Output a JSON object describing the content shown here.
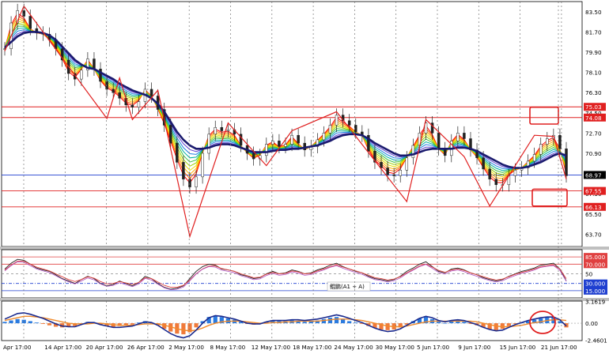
{
  "colors": {
    "grid": "#777777",
    "hline_red": "#e02020",
    "hline_blue": "#1f3fd0",
    "price_label_red": "#e02020",
    "price_label_black": "#000000",
    "ma_thick": "#1a1a6e",
    "zigzag": "#e02020",
    "osc_black": "#222222",
    "osc_red": "#e04040",
    "osc_blue": "#3050e0",
    "osc_purple": "#b050c0",
    "hist_blue": "#2a7be0",
    "hist_orange": "#f07a3a",
    "macd_line": "#1a2a8e",
    "signal_line": "#f08a2a",
    "ribbon": [
      "#ff0000",
      "#ff6a00",
      "#ffb000",
      "#e8e000",
      "#9ad000",
      "#40c040",
      "#00b0a0",
      "#2080e0",
      "#6040d0"
    ]
  },
  "chart_data": [
    {
      "type": "line",
      "panel": "price",
      "ylim": [
        62.6,
        84.4
      ],
      "price_labels": [
        "83.50",
        "81.70",
        "79.90",
        "78.10",
        "76.30",
        "74.50",
        "72.70",
        "70.90",
        "69.10",
        "67.30",
        "65.50",
        "63.70"
      ],
      "price_label_values": [
        83.5,
        81.7,
        79.9,
        78.1,
        76.3,
        74.5,
        72.7,
        70.9,
        69.1,
        67.3,
        65.5,
        63.7
      ],
      "highlighted_labels": [
        {
          "text": "75.03",
          "value": 75.03,
          "color": "#e02020"
        },
        {
          "text": "74.08",
          "value": 74.08,
          "color": "#e02020"
        },
        {
          "text": "68.97",
          "value": 68.97,
          "color": "#000000"
        },
        {
          "text": "67.55",
          "value": 67.55,
          "color": "#e02020"
        },
        {
          "text": "66.13",
          "value": 66.13,
          "color": "#e02020"
        }
      ],
      "horizontal_lines": [
        {
          "value": 75.03,
          "color": "#e02020"
        },
        {
          "value": 74.08,
          "color": "#e02020"
        },
        {
          "value": 68.97,
          "color": "#1f3fd0"
        },
        {
          "value": 67.55,
          "color": "#e02020"
        },
        {
          "value": 66.13,
          "color": "#e02020"
        }
      ],
      "price_close": [
        80.2,
        82.5,
        83.6,
        83.1,
        82.0,
        81.6,
        81.5,
        81.0,
        80.2,
        79.2,
        78.0,
        77.5,
        78.3,
        79.3,
        78.4,
        77.3,
        76.6,
        76.3,
        75.8,
        75.2,
        75.0,
        75.5,
        76.6,
        76.0,
        74.8,
        73.4,
        71.8,
        70.1,
        68.6,
        67.9,
        68.8,
        70.9,
        72.6,
        73.2,
        72.9,
        73.0,
        72.6,
        71.6,
        70.9,
        70.4,
        70.7,
        71.7,
        72.0,
        71.5,
        71.7,
        72.5,
        71.8,
        71.2,
        71.5,
        72.1,
        72.7,
        73.4,
        74.3,
        73.8,
        73.4,
        72.8,
        72.5,
        71.1,
        70.1,
        69.6,
        69.0,
        68.9,
        69.4,
        70.5,
        71.6,
        72.7,
        73.6,
        72.7,
        71.3,
        70.7,
        72.0,
        72.7,
        72.2,
        71.2,
        70.5,
        69.5,
        68.6,
        68.1,
        68.1,
        68.9,
        69.4,
        69.6,
        70.2,
        70.8,
        71.7,
        72.2,
        72.5,
        71.3,
        68.9
      ],
      "ma_thick": [
        80.3,
        80.8,
        81.3,
        81.6,
        81.7,
        81.7,
        81.6,
        81.4,
        81.0,
        80.4,
        79.8,
        79.2,
        78.8,
        78.5,
        78.4,
        78.1,
        77.8,
        77.5,
        77.1,
        76.8,
        76.5,
        76.3,
        76.1,
        75.8,
        75.3,
        74.6,
        73.7,
        72.8,
        72.1,
        71.6,
        71.3,
        71.3,
        71.4,
        71.6,
        71.7,
        71.7,
        71.6,
        71.4,
        71.2,
        71.0,
        71.0,
        71.0,
        71.1,
        71.2,
        71.2,
        71.3,
        71.3,
        71.4,
        71.5,
        71.6,
        71.8,
        72.0,
        72.3,
        72.5,
        72.6,
        72.6,
        72.5,
        72.2,
        71.8,
        71.5,
        71.2,
        70.9,
        70.7,
        70.7,
        70.8,
        71.0,
        71.2,
        71.3,
        71.3,
        71.3,
        71.3,
        71.4,
        71.4,
        71.3,
        71.1,
        70.8,
        70.5,
        70.2,
        69.9,
        69.7,
        69.6,
        69.6,
        69.7,
        69.9,
        70.1,
        70.4,
        70.7,
        70.9,
        70.7
      ],
      "zigzag": [
        {
          "i": 0,
          "v": 80.0
        },
        {
          "i": 3,
          "v": 84.0
        },
        {
          "i": 16,
          "v": 74.0
        },
        {
          "i": 18,
          "v": 77.6
        },
        {
          "i": 20,
          "v": 73.9
        },
        {
          "i": 24,
          "v": 76.5
        },
        {
          "i": 29,
          "v": 63.5
        },
        {
          "i": 35,
          "v": 73.6
        },
        {
          "i": 41,
          "v": 69.8
        },
        {
          "i": 45,
          "v": 72.9
        },
        {
          "i": 52,
          "v": 74.6
        },
        {
          "i": 63,
          "v": 66.6
        },
        {
          "i": 66,
          "v": 73.9
        },
        {
          "i": 72,
          "v": 70.6
        },
        {
          "i": 76,
          "v": 66.2
        },
        {
          "i": 83,
          "v": 72.5
        },
        {
          "i": 86,
          "v": 72.4
        },
        {
          "i": 88,
          "v": 68.6
        }
      ],
      "target_boxes": [
        {
          "top": 75.0,
          "bottom": 73.5
        },
        {
          "top": 67.7,
          "bottom": 66.2
        }
      ]
    },
    {
      "type": "line",
      "panel": "oscillator",
      "ylim": [
        0,
        100
      ],
      "labels": [
        {
          "text": "85.000",
          "value": 85
        },
        {
          "text": "70.000",
          "value": 70
        },
        {
          "text": "50",
          "value": 50
        },
        {
          "text": "30.000",
          "value": 30
        },
        {
          "text": "15.000",
          "value": 15
        }
      ],
      "legend_text": "鲲鹏(A1 + A)",
      "levels": [
        85,
        70,
        50,
        30,
        15
      ],
      "series": [
        {
          "values": [
            60,
            72,
            80,
            78,
            70,
            62,
            58,
            55,
            48,
            40,
            35,
            30,
            38,
            45,
            40,
            30,
            25,
            28,
            35,
            30,
            25,
            32,
            45,
            40,
            30,
            22,
            18,
            20,
            25,
            40,
            55,
            65,
            70,
            68,
            60,
            58,
            55,
            48,
            45,
            40,
            42,
            50,
            55,
            50,
            52,
            58,
            55,
            50,
            52,
            58,
            62,
            68,
            72,
            65,
            60,
            55,
            52,
            45,
            40,
            38,
            35,
            38,
            45,
            55,
            62,
            70,
            75,
            65,
            55,
            52,
            60,
            62,
            58,
            52,
            48,
            42,
            38,
            35,
            38,
            45,
            50,
            55,
            58,
            62,
            68,
            70,
            72,
            60,
            35
          ]
        },
        {
          "values": [
            58,
            68,
            76,
            76,
            70,
            64,
            60,
            56,
            50,
            44,
            38,
            34,
            38,
            44,
            41,
            34,
            29,
            30,
            34,
            31,
            28,
            32,
            42,
            40,
            33,
            26,
            22,
            22,
            26,
            37,
            50,
            60,
            66,
            66,
            61,
            58,
            55,
            50,
            46,
            42,
            43,
            49,
            53,
            50,
            51,
            56,
            54,
            50,
            51,
            56,
            60,
            65,
            68,
            64,
            60,
            56,
            52,
            47,
            42,
            40,
            37,
            39,
            44,
            52,
            59,
            66,
            70,
            64,
            57,
            53,
            58,
            60,
            57,
            52,
            48,
            44,
            40,
            37,
            39,
            44,
            49,
            53,
            56,
            60,
            65,
            67,
            68,
            60,
            40
          ]
        }
      ]
    },
    {
      "type": "bar",
      "panel": "macd",
      "ylim": [
        -2.5,
        3.2
      ],
      "labels": [
        {
          "text": "3.1619",
          "value": 3.1619
        },
        {
          "text": "0.00",
          "value": 0
        },
        {
          "text": "-2.4601",
          "value": -2.4601
        }
      ],
      "histogram": [
        0.2,
        0.4,
        0.6,
        0.5,
        0.3,
        0.1,
        -0.1,
        -0.3,
        -0.5,
        -0.6,
        -0.5,
        -0.4,
        -0.1,
        0.2,
        0.1,
        -0.2,
        -0.4,
        -0.5,
        -0.4,
        -0.3,
        -0.2,
        0.1,
        0.3,
        0.1,
        -0.3,
        -0.8,
        -1.2,
        -1.5,
        -1.6,
        -1.3,
        -0.6,
        0.3,
        0.9,
        1.1,
        0.9,
        0.7,
        0.5,
        0.2,
        -0.1,
        -0.2,
        -0.1,
        0.2,
        0.4,
        0.3,
        0.3,
        0.4,
        0.3,
        0.2,
        0.3,
        0.4,
        0.6,
        0.8,
        0.9,
        0.6,
        0.3,
        0.1,
        -0.1,
        -0.4,
        -0.7,
        -0.9,
        -1.0,
        -0.9,
        -0.6,
        -0.2,
        0.3,
        0.7,
        1.0,
        0.6,
        0.2,
        0.0,
        0.3,
        0.4,
        0.2,
        -0.1,
        -0.3,
        -0.6,
        -0.9,
        -1.0,
        -0.8,
        -0.4,
        -0.1,
        0.1,
        0.3,
        0.5,
        0.7,
        0.8,
        0.8,
        0.3,
        -0.6
      ],
      "macd_line": [
        0.6,
        1.0,
        1.4,
        1.5,
        1.3,
        1.0,
        0.7,
        0.3,
        -0.1,
        -0.4,
        -0.5,
        -0.5,
        -0.2,
        0.1,
        0.1,
        -0.2,
        -0.4,
        -0.6,
        -0.6,
        -0.5,
        -0.4,
        -0.1,
        0.2,
        0.1,
        -0.3,
        -0.9,
        -1.5,
        -1.9,
        -2.1,
        -1.8,
        -1.0,
        0.0,
        0.8,
        1.1,
        1.0,
        0.8,
        0.6,
        0.3,
        0.0,
        -0.1,
        -0.1,
        0.2,
        0.4,
        0.4,
        0.4,
        0.5,
        0.5,
        0.4,
        0.5,
        0.6,
        0.8,
        1.0,
        1.2,
        1.0,
        0.7,
        0.4,
        0.1,
        -0.3,
        -0.7,
        -1.0,
        -1.2,
        -1.1,
        -0.8,
        -0.3,
        0.2,
        0.7,
        1.0,
        0.8,
        0.4,
        0.2,
        0.4,
        0.5,
        0.4,
        0.1,
        -0.2,
        -0.6,
        -0.9,
        -1.1,
        -1.0,
        -0.6,
        -0.2,
        0.1,
        0.4,
        0.6,
        0.8,
        0.9,
        0.9,
        0.5,
        -0.4
      ],
      "signal_line": [
        0.4,
        0.6,
        0.8,
        1.0,
        1.0,
        0.9,
        0.8,
        0.6,
        0.4,
        0.2,
        0.0,
        -0.1,
        -0.1,
        -0.1,
        0.0,
        0.0,
        -0.1,
        -0.2,
        -0.3,
        -0.3,
        -0.3,
        -0.2,
        -0.1,
        -0.1,
        -0.1,
        -0.3,
        -0.5,
        -0.8,
        -1.0,
        -1.1,
        -1.0,
        -0.7,
        -0.3,
        0.0,
        0.2,
        0.3,
        0.3,
        0.3,
        0.2,
        0.1,
        0.0,
        0.0,
        0.1,
        0.1,
        0.2,
        0.2,
        0.3,
        0.3,
        0.3,
        0.3,
        0.4,
        0.5,
        0.6,
        0.6,
        0.6,
        0.5,
        0.4,
        0.2,
        0.0,
        -0.2,
        -0.4,
        -0.5,
        -0.5,
        -0.4,
        -0.2,
        0.0,
        0.2,
        0.3,
        0.3,
        0.3,
        0.3,
        0.3,
        0.3,
        0.3,
        0.2,
        0.0,
        -0.2,
        -0.4,
        -0.5,
        -0.5,
        -0.4,
        -0.3,
        -0.1,
        0.1,
        0.2,
        0.4,
        0.5,
        0.5,
        0.4
      ]
    }
  ],
  "x_axis_labels": [
    "Apr 17:00",
    "14 Apr 17:00",
    "20 Apr 17:00",
    "26 Apr 17:00",
    "2 May 17:00",
    "8 May 17:00",
    "12 May 17:00",
    "18 May 17:00",
    "24 May 17:00",
    "30 May 17:00",
    "5 Jun 17:00",
    "9 Jun 17:00",
    "15 Jun 17:00",
    "21 Jun 17:00"
  ]
}
